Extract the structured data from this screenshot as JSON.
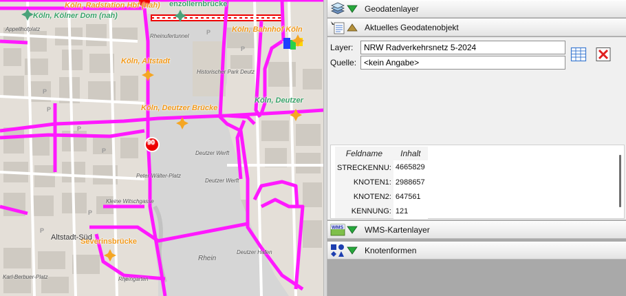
{
  "map": {
    "labels": {
      "radstation": "Köln, Radstation Hbf (nah)",
      "dom": "Köln, Kölner Dom (nah)",
      "hohenzollern": "enzollernbrücke",
      "bahnhof_koeln": "Köln, Bahnhof Köln",
      "altstadt": "Köln, Altstadt",
      "deutzer_bruecke": "Köln, Deutzer Brücke",
      "deutzer": "Köln, Deutzer",
      "severinsbruecke": "Severinsbrücke",
      "appellhofplatz": "Appellhofplatz",
      "rheinufertunnel": "Rheinufertunnel",
      "historischer_park": "Historischer Park Deutz",
      "deutzer_werft_1": "Deutzer Werft",
      "deutzer_werft_2": "Deutzer Werft",
      "peter_waelter": "Peter-Wälter-Platz",
      "altstadt_sued": "Altstadt-Süd",
      "rhein": "Rhein",
      "deutzer_hafen": "Deutzer Hafen",
      "karl_berbuer": "Karl-Berbuer-Platz",
      "kleine_witschgasse": "Kleine Witschgasse",
      "rheingarten": "Rheingarten"
    },
    "speed_sign": "90"
  },
  "panel": {
    "sections": {
      "geodatenlayer": "Geodatenlayer",
      "geodatenobjekt": "Aktuelles Geodatenobjekt",
      "wms": "WMS-Kartenlayer",
      "knotenformen": "Knotenformen"
    },
    "layer_label": "Layer:",
    "layer_value": "NRW Radverkehrsnetz 5-2024",
    "quelle_label": "Quelle:",
    "quelle_value": "<kein Angabe>",
    "table": {
      "headers": [
        "Feldname",
        "Inhalt"
      ],
      "rows": [
        {
          "key": "STRECKENNU:",
          "value": "4665829"
        },
        {
          "key": "KNOTEN1:",
          "value": "2988657"
        },
        {
          "key": "KNOTEN2:",
          "value": "647561"
        },
        {
          "key": "KENNUNG:",
          "value": "121"
        }
      ]
    },
    "wms_icon_text": "WMS"
  },
  "colors": {
    "route": "#ff19ff",
    "river": "#d6d6d6",
    "map_bg": "#e4dfd8",
    "node_orange": "#f5a623",
    "node_green": "#4aa37a"
  }
}
